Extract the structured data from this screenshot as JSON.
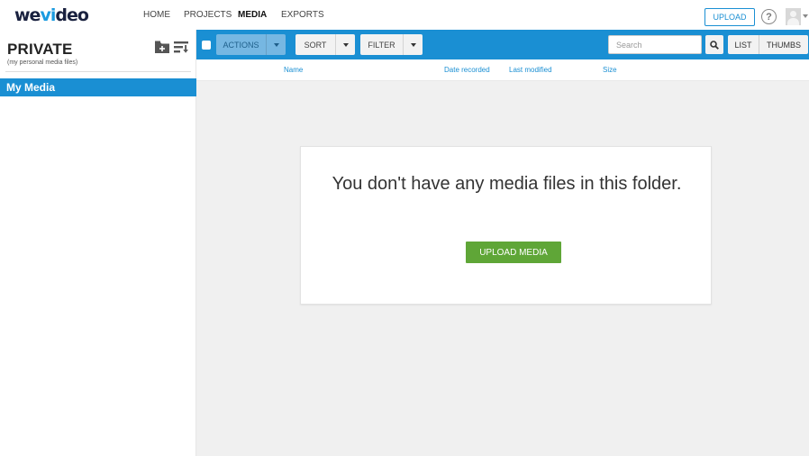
{
  "brand": {
    "logo_we": "we",
    "logo_vi": "vi",
    "logo_deo": "deo",
    "accent": "#1a8fd3",
    "green": "#5fa637"
  },
  "nav": {
    "home": "HOME",
    "projects": "PROJECTS",
    "media": "MEDIA",
    "exports": "EXPORTS",
    "active": "MEDIA"
  },
  "header": {
    "upload_label": "UPLOAD",
    "help_icon": "?"
  },
  "sidebar": {
    "title": "PRIVATE",
    "subtitle": "(my personal media files)",
    "items": [
      {
        "label": "My Media",
        "selected": true
      }
    ]
  },
  "toolbar": {
    "actions_label": "ACTIONS",
    "sort_label": "SORT",
    "filter_label": "FILTER",
    "search_placeholder": "Search",
    "list_label": "LIST",
    "thumbs_label": "THUMBS"
  },
  "columns": {
    "name": "Name",
    "date_recorded": "Date recorded",
    "last_modified": "Last modified",
    "size": "Size"
  },
  "empty_state": {
    "message": "You don't have any media files in this folder.",
    "button_label": "UPLOAD MEDIA"
  }
}
